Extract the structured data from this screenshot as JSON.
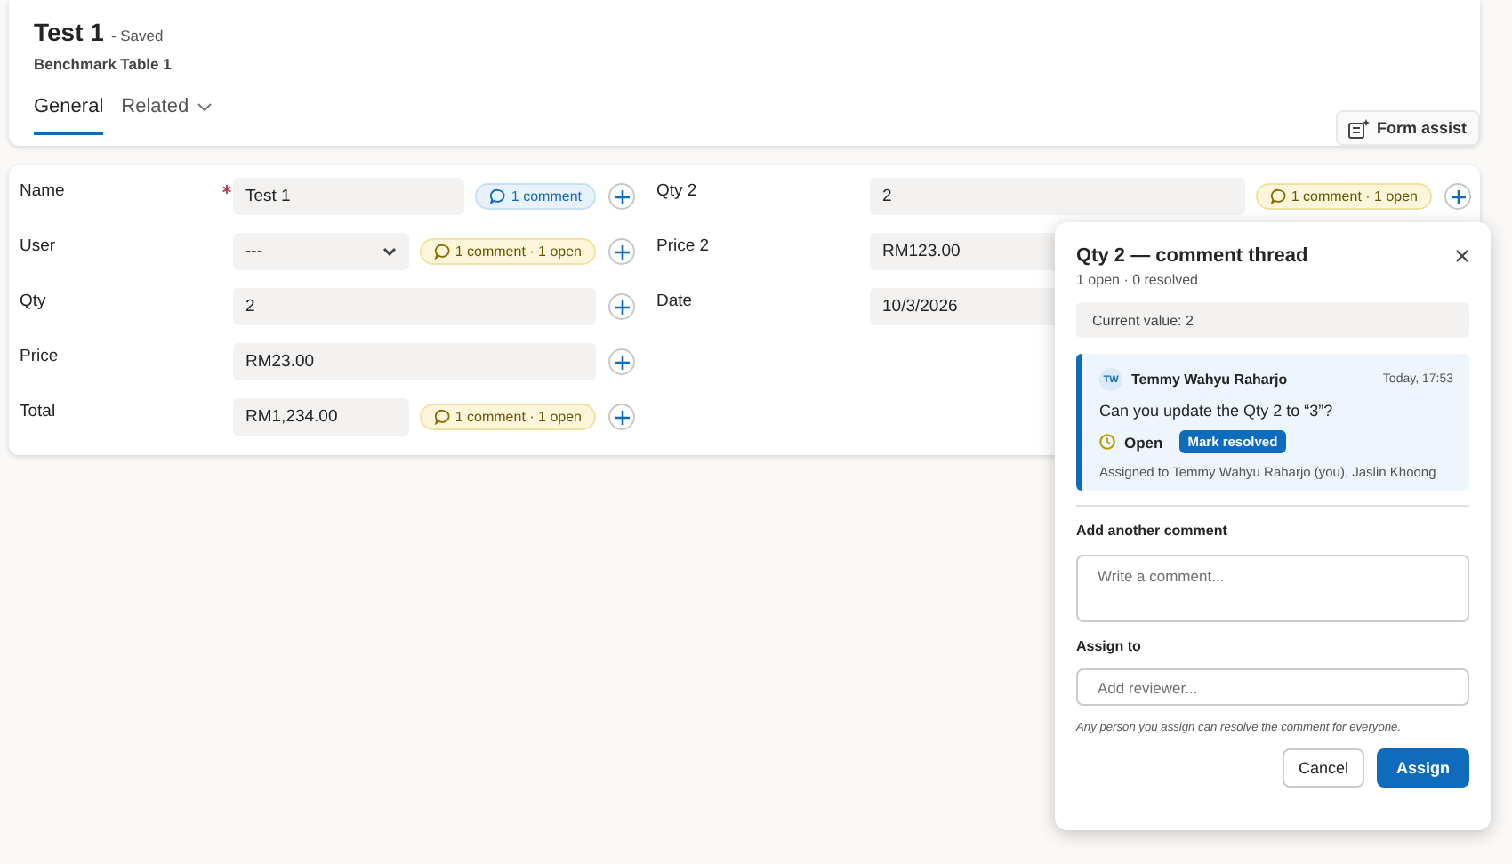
{
  "header": {
    "title": "Test 1",
    "status": "- Saved",
    "subtitle": "Benchmark Table 1",
    "tabs": [
      {
        "label": "General",
        "selected": true,
        "dropdown": false
      },
      {
        "label": "Related",
        "selected": false,
        "dropdown": true
      }
    ],
    "form_assist": "Form assist"
  },
  "form": {
    "columns": [
      {
        "fields": [
          {
            "label": "Name",
            "required": true,
            "kind": "text",
            "value": "Test 1",
            "comment": {
              "text": "1 comment",
              "open": false
            },
            "add_button": true
          },
          {
            "label": "User",
            "required": false,
            "kind": "select",
            "value": "---",
            "comment": {
              "text": "1 comment · 1 open",
              "open": true
            },
            "add_button": true
          },
          {
            "label": "Qty",
            "required": false,
            "kind": "text",
            "value": "2",
            "add_button": true
          },
          {
            "label": "Price",
            "required": false,
            "kind": "text",
            "value": "RM23.00",
            "add_button": true
          },
          {
            "label": "Total",
            "required": false,
            "kind": "text",
            "value": "RM1,234.00",
            "comment": {
              "text": "1 comment · 1 open",
              "open": true
            },
            "add_button": true
          }
        ]
      },
      {
        "fields": [
          {
            "label": "Qty 2",
            "required": false,
            "kind": "text",
            "value": "2",
            "comment": {
              "text": "1 comment · 1 open",
              "open": true
            },
            "add_button": true
          },
          {
            "label": "Price 2",
            "required": false,
            "kind": "text",
            "value": "RM123.00",
            "add_button": false
          },
          {
            "label": "Date",
            "required": false,
            "kind": "text",
            "value": "10/3/2026",
            "add_button": false
          }
        ]
      }
    ]
  },
  "popup": {
    "title": "Qty 2 — comment thread",
    "summary": "1 open · 0 resolved",
    "current_value": "Current value: 2",
    "comments": [
      {
        "initials": "TW",
        "author": "Temmy Wahyu Raharjo",
        "time": "Today, 17:53",
        "text": "Can you update the Qty 2 to “3”?",
        "resolved": false,
        "status_label": "Open",
        "action": "Mark resolved",
        "assigned": "Assigned to Temmy Wahyu Raharjo (you), Jaslin Khoong"
      }
    ],
    "comment_label": "Add another comment",
    "comment_placeholder": "Write a comment...",
    "assign_label": "Assign to",
    "assign_placeholder": "Add reviewer...",
    "note": "Any person you assign can resolve the comment for everyone.",
    "buttons": [
      {
        "label": "Cancel",
        "kind": "secondary"
      },
      {
        "label": "Assign",
        "kind": "primary"
      }
    ]
  }
}
